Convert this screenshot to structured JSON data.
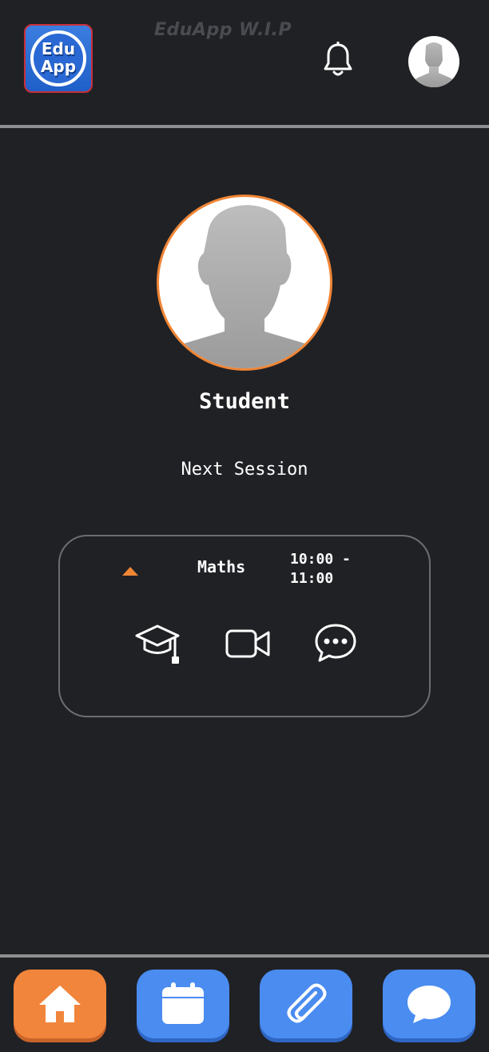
{
  "header": {
    "logo_line1": "Edu",
    "logo_line2": "App",
    "title": "EduApp W.I.P",
    "notification_icon": "bell-icon",
    "avatar_icon": "user-avatar"
  },
  "profile": {
    "name": "Student",
    "accent": "#f08535"
  },
  "next_session": {
    "label": "Next Session",
    "subject": "Maths",
    "time": "10:00 - 11:00",
    "actions": [
      "graduation-cap-icon",
      "video-camera-icon",
      "chat-bubble-dots-icon"
    ]
  },
  "bottom_nav": {
    "items": [
      {
        "icon": "home-icon",
        "active": true,
        "color": "#f0853b"
      },
      {
        "icon": "calendar-icon",
        "active": false,
        "color": "#4a8cf0"
      },
      {
        "icon": "paperclip-icon",
        "active": false,
        "color": "#4a8cf0"
      },
      {
        "icon": "speech-bubble-icon",
        "active": false,
        "color": "#4a8cf0"
      }
    ]
  },
  "colors": {
    "background": "#202125",
    "accent": "#f08535",
    "nav_blue": "#4a8cf0"
  }
}
